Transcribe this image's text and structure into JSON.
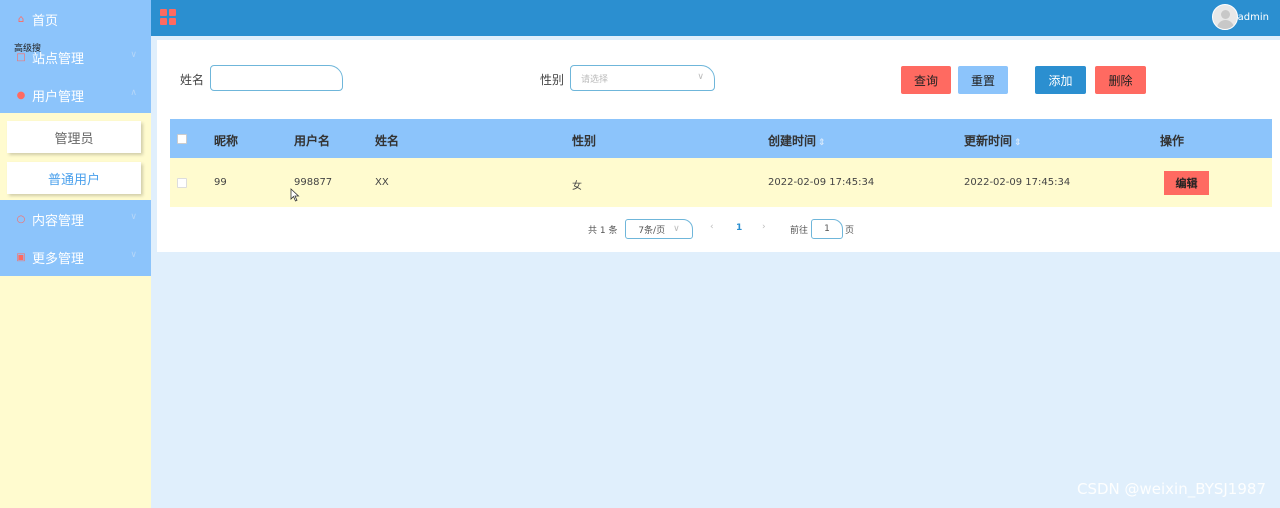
{
  "sidebar": {
    "overlay": "高级搜",
    "items": [
      {
        "label": "首页",
        "icon": "home-icon"
      },
      {
        "label": "站点管理",
        "icon": "site-icon"
      },
      {
        "label": "用户管理",
        "icon": "user-icon"
      },
      {
        "label": "内容管理",
        "icon": "content-icon"
      },
      {
        "label": "更多管理",
        "icon": "more-icon"
      }
    ],
    "submenu": [
      {
        "label": "管理员"
      },
      {
        "label": "普通用户"
      }
    ]
  },
  "header": {
    "username": "admin",
    "icon": "grid-menu-icon"
  },
  "search": {
    "name_label": "姓名",
    "name_value": "",
    "gender_label": "性别",
    "gender_placeholder": "请选择",
    "query_label": "查询",
    "reset_label": "重置",
    "add_label": "添加",
    "delete_label": "删除"
  },
  "table": {
    "columns": [
      "昵称",
      "用户名",
      "姓名",
      "性别",
      "创建时间",
      "更新时间",
      "操作"
    ],
    "rows": [
      {
        "nickname": "99",
        "username": "998877",
        "name": "XX",
        "gender": "女",
        "created": "2022-02-09 17:45:34",
        "updated": "2022-02-09 17:45:34",
        "action": "编辑"
      }
    ]
  },
  "pagination": {
    "total": "共 1 条",
    "page_size": "7条/页",
    "current_page": "1",
    "goto_label": "前往",
    "goto_value": "1",
    "page_suffix": "页"
  },
  "watermark": "CSDN @weixin_BYSJ1987",
  "colors": {
    "sidebar_bg": "#fffbcf",
    "menu_bg": "#8cc4fb",
    "topbar_bg": "#2b8fd0",
    "accent_red": "#ff6a61",
    "page_bg": "#e0effc"
  }
}
